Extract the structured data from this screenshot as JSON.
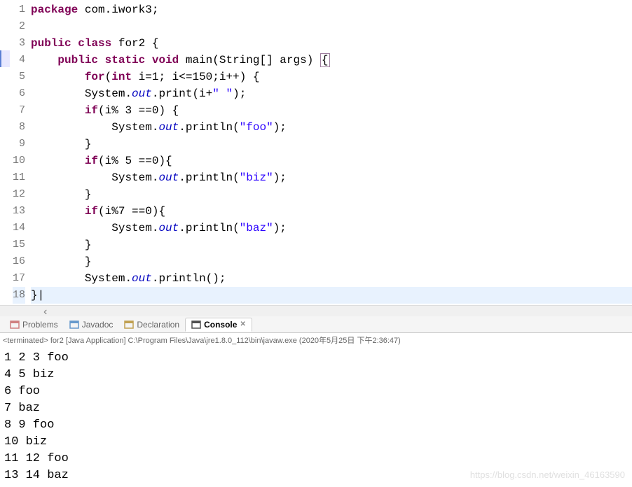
{
  "editor": {
    "lines": [
      {
        "n": 1,
        "tokens": [
          {
            "t": "package",
            "c": "kw-purple"
          },
          {
            "t": " com.iwork3;",
            "c": ""
          }
        ]
      },
      {
        "n": 2,
        "tokens": []
      },
      {
        "n": 3,
        "tokens": [
          {
            "t": "public",
            "c": "kw-purple"
          },
          {
            "t": " ",
            "c": ""
          },
          {
            "t": "class",
            "c": "kw-purple"
          },
          {
            "t": " for2 {",
            "c": ""
          }
        ]
      },
      {
        "n": 4,
        "tokens": [
          {
            "t": "    ",
            "c": ""
          },
          {
            "t": "public",
            "c": "kw-purple"
          },
          {
            "t": " ",
            "c": ""
          },
          {
            "t": "static",
            "c": "kw-purple"
          },
          {
            "t": " ",
            "c": ""
          },
          {
            "t": "void",
            "c": "kw-purple"
          },
          {
            "t": " main(String[] args) ",
            "c": ""
          },
          {
            "t": "{",
            "c": "box-cursor"
          }
        ]
      },
      {
        "n": 5,
        "tokens": [
          {
            "t": "        ",
            "c": ""
          },
          {
            "t": "for",
            "c": "kw-purple"
          },
          {
            "t": "(",
            "c": ""
          },
          {
            "t": "int",
            "c": "kw-purple"
          },
          {
            "t": " i=1; i<=150;i++) {",
            "c": ""
          }
        ]
      },
      {
        "n": 6,
        "tokens": [
          {
            "t": "        System.",
            "c": ""
          },
          {
            "t": "out",
            "c": "field-italic"
          },
          {
            "t": ".print(i+",
            "c": ""
          },
          {
            "t": "\" \"",
            "c": "str"
          },
          {
            "t": ");",
            "c": ""
          }
        ]
      },
      {
        "n": 7,
        "tokens": [
          {
            "t": "        ",
            "c": ""
          },
          {
            "t": "if",
            "c": "kw-purple"
          },
          {
            "t": "(i% 3 ==0) {",
            "c": ""
          }
        ]
      },
      {
        "n": 8,
        "tokens": [
          {
            "t": "            System.",
            "c": ""
          },
          {
            "t": "out",
            "c": "field-italic"
          },
          {
            "t": ".println(",
            "c": ""
          },
          {
            "t": "\"foo\"",
            "c": "str"
          },
          {
            "t": ");",
            "c": ""
          }
        ]
      },
      {
        "n": 9,
        "tokens": [
          {
            "t": "        }",
            "c": ""
          }
        ]
      },
      {
        "n": 10,
        "tokens": [
          {
            "t": "        ",
            "c": ""
          },
          {
            "t": "if",
            "c": "kw-purple"
          },
          {
            "t": "(i% 5 ==0){",
            "c": ""
          }
        ]
      },
      {
        "n": 11,
        "tokens": [
          {
            "t": "            System.",
            "c": ""
          },
          {
            "t": "out",
            "c": "field-italic"
          },
          {
            "t": ".println(",
            "c": ""
          },
          {
            "t": "\"biz\"",
            "c": "str"
          },
          {
            "t": ");",
            "c": ""
          }
        ]
      },
      {
        "n": 12,
        "tokens": [
          {
            "t": "        }",
            "c": ""
          }
        ]
      },
      {
        "n": 13,
        "tokens": [
          {
            "t": "        ",
            "c": ""
          },
          {
            "t": "if",
            "c": "kw-purple"
          },
          {
            "t": "(i%7 ==0){",
            "c": ""
          }
        ]
      },
      {
        "n": 14,
        "tokens": [
          {
            "t": "            System.",
            "c": ""
          },
          {
            "t": "out",
            "c": "field-italic"
          },
          {
            "t": ".println(",
            "c": ""
          },
          {
            "t": "\"baz\"",
            "c": "str"
          },
          {
            "t": ");",
            "c": ""
          }
        ]
      },
      {
        "n": 15,
        "tokens": [
          {
            "t": "        }",
            "c": ""
          }
        ]
      },
      {
        "n": 16,
        "tokens": [
          {
            "t": "        }",
            "c": ""
          }
        ]
      },
      {
        "n": 17,
        "tokens": [
          {
            "t": "        System.",
            "c": ""
          },
          {
            "t": "out",
            "c": "field-italic"
          },
          {
            "t": ".println();",
            "c": ""
          }
        ]
      },
      {
        "n": 18,
        "tokens": [
          {
            "t": "}",
            "c": ""
          },
          {
            "t": "|",
            "c": ""
          }
        ]
      }
    ],
    "highlighted_line": 18,
    "marker_line": 4
  },
  "tabs": {
    "items": [
      {
        "label": "Problems",
        "icon": "problems-icon",
        "active": false
      },
      {
        "label": "Javadoc",
        "icon": "javadoc-icon",
        "active": false
      },
      {
        "label": "Declaration",
        "icon": "declaration-icon",
        "active": false
      },
      {
        "label": "Console",
        "icon": "console-icon",
        "active": true
      }
    ]
  },
  "console": {
    "header": "<terminated> for2 [Java Application] C:\\Program Files\\Java\\jre1.8.0_112\\bin\\javaw.exe (2020年5月25日 下午2:36:47)",
    "output": [
      "1 2 3 foo",
      "4 5 biz",
      "6 foo",
      "7 baz",
      "8 9 foo",
      "10 biz",
      "11 12 foo",
      "13 14 baz"
    ]
  },
  "watermark": "https://blog.csdn.net/weixin_46163590"
}
